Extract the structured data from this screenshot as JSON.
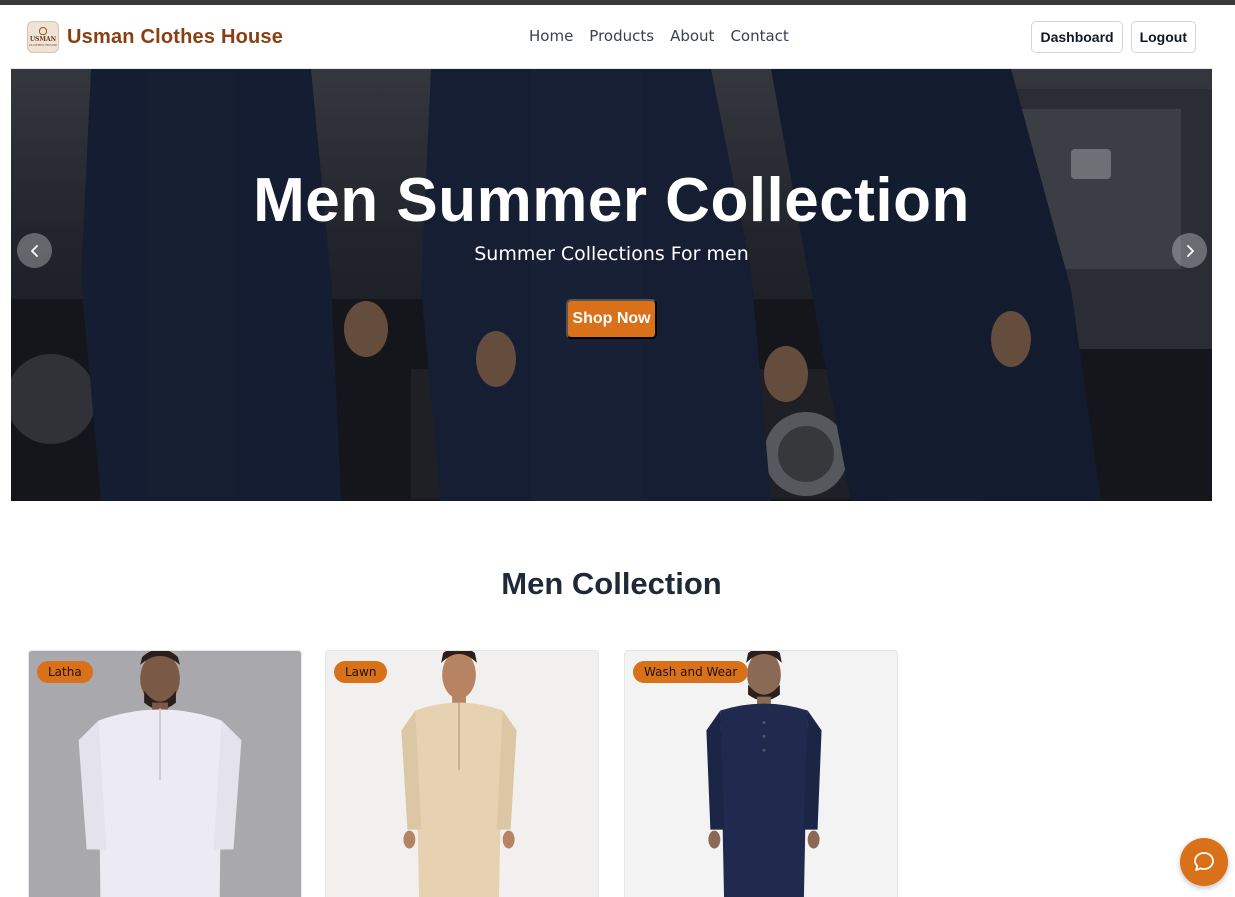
{
  "brand": {
    "logo_text": "USMAN",
    "logo_subtext": "CLOTHES HOUSE",
    "name": "Usman Clothes House"
  },
  "nav": {
    "links": [
      "Home",
      "Products",
      "About",
      "Contact"
    ],
    "dashboard_label": "Dashboard",
    "logout_label": "Logout"
  },
  "hero": {
    "title": "Men Summer Collection",
    "subtitle": "Summer Collections For men",
    "cta_label": "Shop Now"
  },
  "section": {
    "title": "Men Collection"
  },
  "products": [
    {
      "badge": "Latha"
    },
    {
      "badge": "Lawn"
    },
    {
      "badge": "Wash and Wear"
    }
  ],
  "colors": {
    "accent": "#d9701a",
    "brand_text": "#8a3f12",
    "heading": "#1f2937"
  },
  "icons": {
    "prev": "chevron-left-icon",
    "next": "chevron-right-icon",
    "chat": "chat-bubble-icon"
  }
}
